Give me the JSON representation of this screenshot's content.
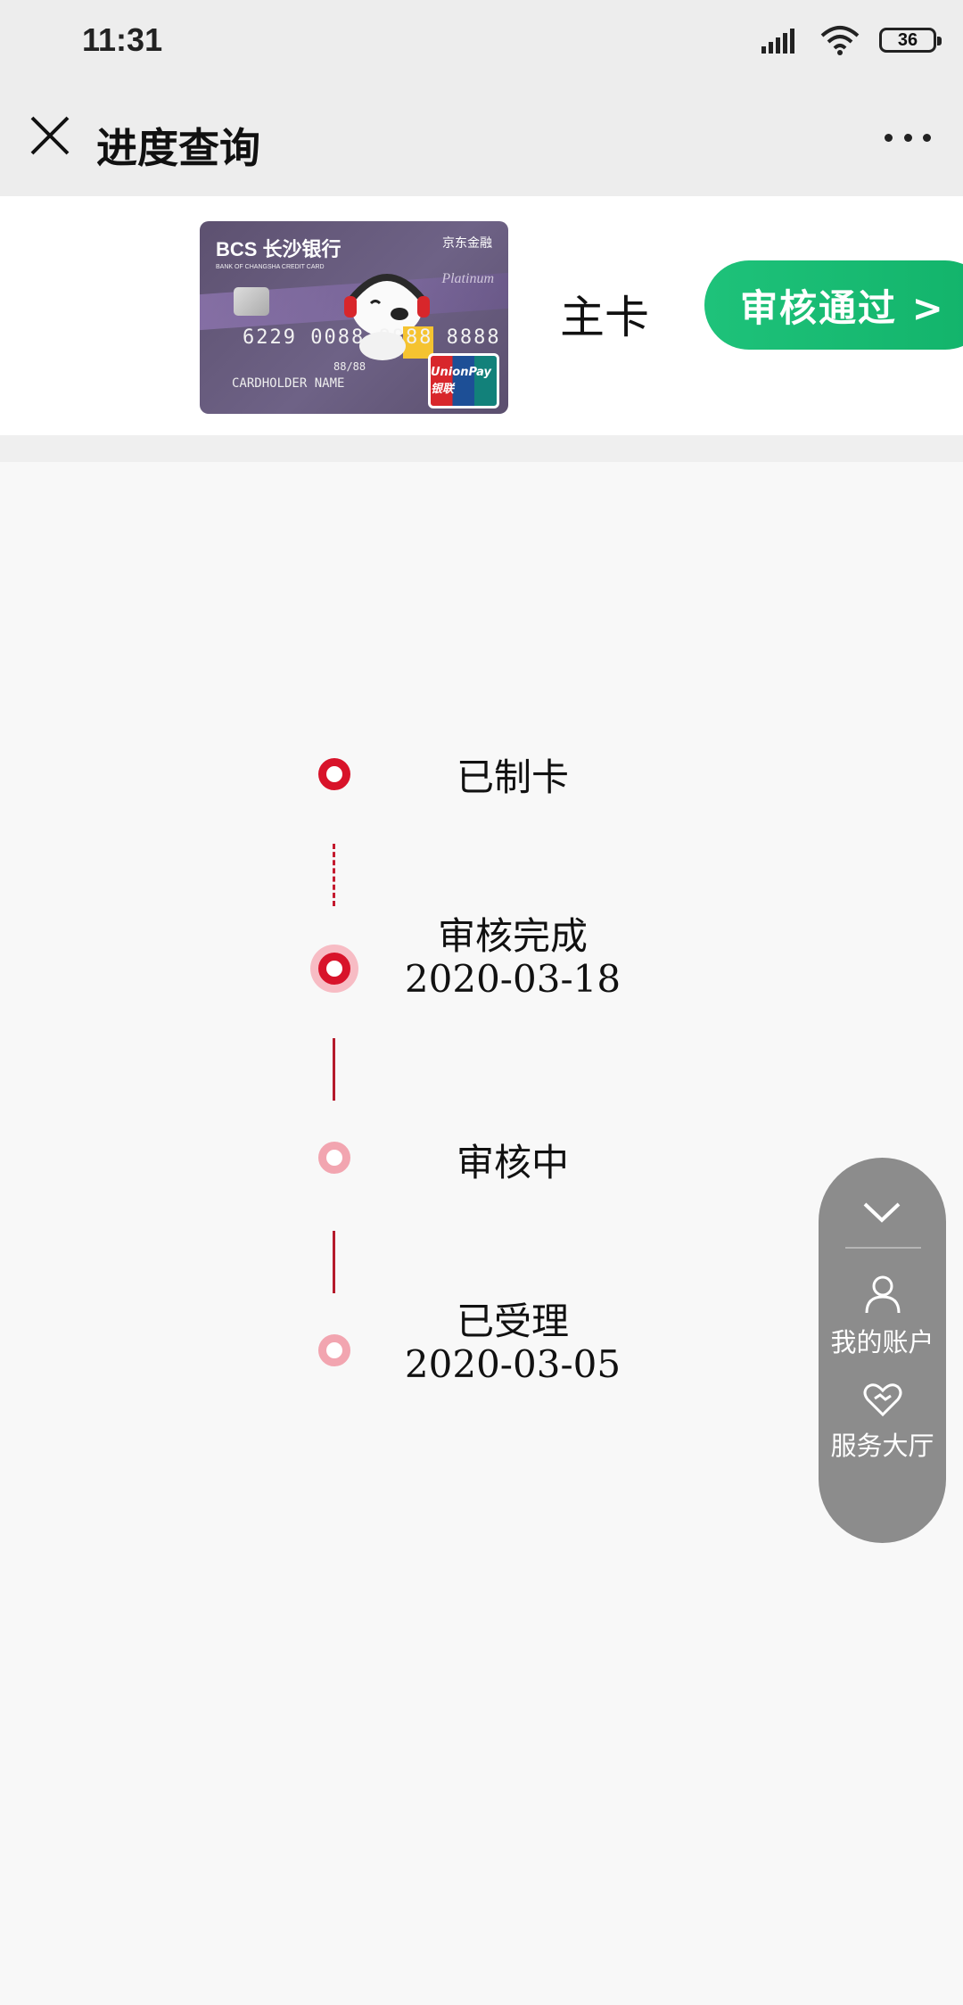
{
  "status_bar": {
    "time": "11:31",
    "battery": "36"
  },
  "nav": {
    "title": "进度查询"
  },
  "card": {
    "bank_name": "BCS 长沙银行",
    "bank_sub": "BANK OF CHANGSHA  CREDIT CARD",
    "partner": "京东金融",
    "tier": "Platinum",
    "number": "6229 0088 8888 8888",
    "expiry": "88/88",
    "holder": "CARDHOLDER NAME",
    "network": "UnionPay 银联",
    "type_label": "主卡",
    "status_button": "审核通过 >"
  },
  "timeline": {
    "steps": [
      {
        "label": "已制卡",
        "date": "",
        "state": "done"
      },
      {
        "label": "审核完成",
        "date": "2020-03-18",
        "state": "current"
      },
      {
        "label": "审核中",
        "date": "",
        "state": "pending"
      },
      {
        "label": "已受理",
        "date": "2020-03-05",
        "state": "pending"
      }
    ]
  },
  "float_menu": {
    "collapse_icon": "chevron-down-icon",
    "items": [
      {
        "label": "我的账户",
        "icon": "user-icon"
      },
      {
        "label": "服务大厅",
        "icon": "heart-icon"
      }
    ]
  },
  "colors": {
    "accent_red": "#d8132a",
    "pill_green": "#17bb72",
    "panel_gray": "#8c8c8c"
  }
}
